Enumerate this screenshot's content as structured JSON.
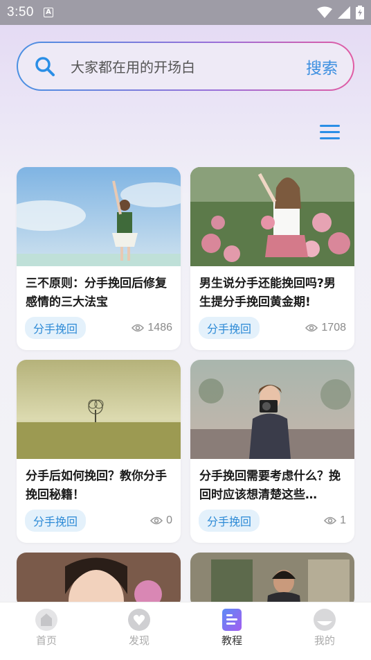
{
  "status": {
    "time": "3:50"
  },
  "search": {
    "placeholder": "大家都在用的开场白",
    "button": "搜索"
  },
  "cards": [
    {
      "title": "三不原则：分手挽回后修复感情的三大法宝",
      "tag": "分手挽回",
      "views": "1486"
    },
    {
      "title": "男生说分手还能挽回吗?男生提分手挽回黄金期!",
      "tag": "分手挽回",
      "views": "1708"
    },
    {
      "title": "分手后如何挽回？教你分手挽回秘籍！",
      "tag": "分手挽回",
      "views": "0"
    },
    {
      "title": "分手挽回需要考虑什么？挽回时应该想清楚这些…",
      "tag": "分手挽回",
      "views": "1"
    }
  ],
  "nav": [
    {
      "label": "首页",
      "icon": "home-icon"
    },
    {
      "label": "发现",
      "icon": "discover-heart-icon"
    },
    {
      "label": "教程",
      "icon": "tutorial-doc-icon"
    },
    {
      "label": "我的",
      "icon": "profile-face-icon"
    }
  ],
  "colors": {
    "accent": "#3c8fe0",
    "active_nav": "#7b5cf0",
    "tag_bg": "#e4f1fb"
  }
}
